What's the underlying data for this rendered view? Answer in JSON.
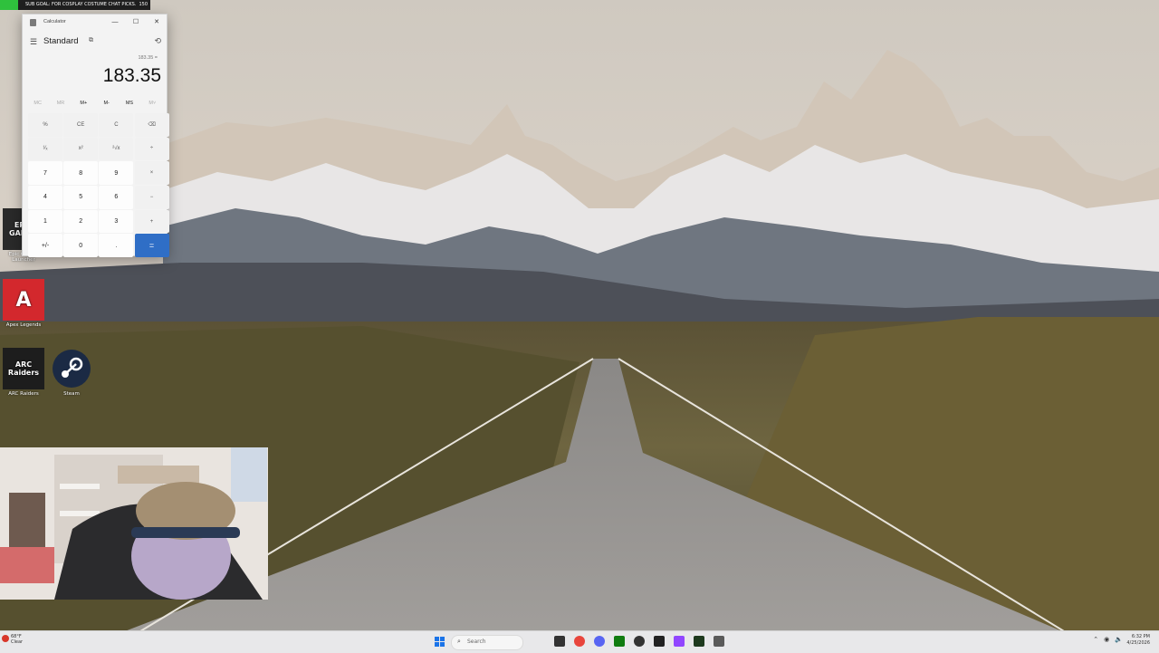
{
  "goal_bar": {
    "text": "SUB GOAL: FOR COSPLAY COSTUME CHAT PICKS.",
    "count": "150",
    "progress": 0.12,
    "color": "#2fc13d"
  },
  "desktop_icons": [
    {
      "label": "Epic Games Launcher",
      "tile_text": "EPIC GAMES",
      "color": "#2a2a2a"
    },
    {
      "label": "Apex Legends",
      "tile_text": "A",
      "color": "#d3282d"
    },
    {
      "label": "ARC Raiders",
      "tile_text": "ARC Raiders",
      "color": "#1d1d1d"
    },
    {
      "label": "Steam",
      "tile_text": "",
      "color": "#1b2a44"
    }
  ],
  "calculator": {
    "window_title": "Calculator",
    "window_buttons": {
      "minimize": "—",
      "maximize": "☐",
      "close": "✕"
    },
    "mode": "Standard",
    "expression": "183.35 =",
    "display": "183.35",
    "memory": [
      "MC",
      "MR",
      "M+",
      "M-",
      "MS",
      "M˅"
    ],
    "keys": [
      "%",
      "CE",
      "C",
      "⌫",
      "¹⁄ₓ",
      "x²",
      "²√x",
      "÷",
      "7",
      "8",
      "9",
      "×",
      "4",
      "5",
      "6",
      "−",
      "1",
      "2",
      "3",
      "+",
      "+/-",
      "0",
      ".",
      "="
    ],
    "accent": "#2f6ec6"
  },
  "taskbar": {
    "weather_temp": "68°F",
    "weather_desc": "Clear",
    "search_label": "Search",
    "time": "6:32 PM",
    "date": "4/25/2026",
    "apps": [
      "file-explorer-icon",
      "chrome-icon",
      "discord-icon",
      "xbox-icon",
      "obs-icon",
      "stream-deck-icon",
      "twitch-icon",
      "cursor-icon",
      "calculator-icon"
    ]
  }
}
